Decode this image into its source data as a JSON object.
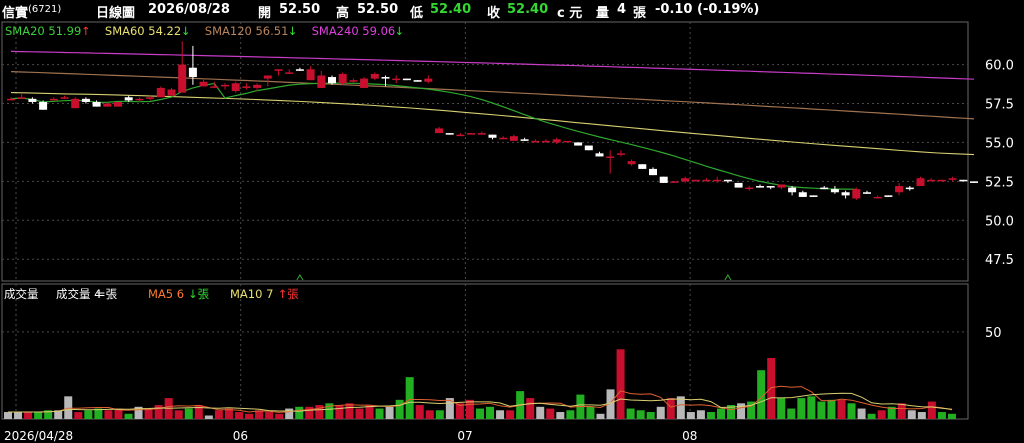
{
  "header": {
    "name": "信實",
    "code": "(6721)",
    "period": "日線圖",
    "date": "2026/08/28",
    "open_label": "開",
    "open": "52.50",
    "high_label": "高",
    "high": "52.50",
    "low_label": "低",
    "low": "52.40",
    "close_label": "收",
    "close": "52.40",
    "unit": "c 元",
    "vol_label": "量",
    "vol": "4",
    "vol_unit": "張",
    "change": "-0.10 (-0.19%)"
  },
  "sma_legend": [
    {
      "label": "SMA20",
      "value": "51.99",
      "arrow": "↑",
      "color": "#3ccf3c",
      "arrow_color": "#ff3333"
    },
    {
      "label": "SMA60",
      "value": "54.22",
      "arrow": "↓",
      "color": "#e8e070",
      "arrow_color": "#33dd33"
    },
    {
      "label": "SMA120",
      "value": "56.51",
      "arrow": "↓",
      "color": "#b8845c",
      "arrow_color": "#33dd33"
    },
    {
      "label": "SMA240",
      "value": "59.06",
      "arrow": "↓",
      "color": "#e040e0",
      "arrow_color": "#33dd33"
    }
  ],
  "vol_legend": [
    {
      "label": "成交量",
      "color": "#ffffff"
    },
    {
      "label": "成交量 4",
      "suffix": "=張",
      "color": "#ffffff",
      "suffix_color": "#ffffff"
    },
    {
      "label": "MA5 6",
      "suffix": "↓張",
      "color": "#ff7a30",
      "suffix_color": "#33dd33"
    },
    {
      "label": "MA10 7",
      "suffix": "↑張",
      "color": "#e8e070",
      "suffix_color": "#ff3333"
    }
  ],
  "colors": {
    "up": "#c8102e",
    "down": "#ffffff",
    "vol_up": "#c8102e",
    "vol_down": "#22b022",
    "vol_flat": "#b8b8b8",
    "grid": "#4a4a4a"
  },
  "chart_data": {
    "type": "candlestick",
    "price_ticks": [
      "60.0",
      "57.5",
      "55.0",
      "52.5",
      "50.0",
      "47.5"
    ],
    "price_tick_values": [
      60,
      57.5,
      55,
      52.5,
      50,
      47.5
    ],
    "ylim": [
      46.1,
      62.8
    ],
    "volume_ticks": [
      "50"
    ],
    "volume_tick_values": [
      50
    ],
    "volume_ylim": [
      0,
      70
    ],
    "x_labels": [
      "2026/04/28",
      "06",
      "07",
      "08"
    ],
    "x_label_index": [
      0,
      21,
      42,
      63
    ],
    "ohlc": [
      [
        57.8,
        57.9,
        57.7,
        57.8
      ],
      [
        57.8,
        58.1,
        57.8,
        57.9
      ],
      [
        57.8,
        57.9,
        57.5,
        57.6
      ],
      [
        57.6,
        57.7,
        57.1,
        57.1
      ],
      [
        57.8,
        57.9,
        57.8,
        57.8
      ],
      [
        57.9,
        58.0,
        57.8,
        57.9
      ],
      [
        57.2,
        57.9,
        57.2,
        57.8
      ],
      [
        57.8,
        57.9,
        57.5,
        57.6
      ],
      [
        57.6,
        57.7,
        57.3,
        57.3
      ],
      [
        57.3,
        57.6,
        57.3,
        57.5
      ],
      [
        57.3,
        57.6,
        57.3,
        57.6
      ],
      [
        57.9,
        58.0,
        57.6,
        57.7
      ],
      [
        57.8,
        57.9,
        57.6,
        57.8
      ],
      [
        57.8,
        58.0,
        57.7,
        57.9
      ],
      [
        57.9,
        58.6,
        57.9,
        58.5
      ],
      [
        58.0,
        58.5,
        58.0,
        58.4
      ],
      [
        58.2,
        61.5,
        58.2,
        60.0
      ],
      [
        59.8,
        61.2,
        58.7,
        59.2
      ],
      [
        58.6,
        59.1,
        58.6,
        58.9
      ],
      [
        58.6,
        58.9,
        58.5,
        58.6
      ],
      [
        58.6,
        58.8,
        58.4,
        58.7
      ],
      [
        58.3,
        58.9,
        58.2,
        58.8
      ],
      [
        58.5,
        58.8,
        58.4,
        58.6
      ],
      [
        58.5,
        58.8,
        58.3,
        58.7
      ],
      [
        59.1,
        59.3,
        58.6,
        59.3
      ],
      [
        59.6,
        59.7,
        59.3,
        59.7
      ],
      [
        59.5,
        59.7,
        59.4,
        59.5
      ],
      [
        59.7,
        59.8,
        59.6,
        59.6
      ],
      [
        59.0,
        59.9,
        59.0,
        59.7
      ],
      [
        58.5,
        59.6,
        58.5,
        59.3
      ],
      [
        59.2,
        59.3,
        58.7,
        58.8
      ],
      [
        58.8,
        59.5,
        58.7,
        59.4
      ],
      [
        58.9,
        59.1,
        58.8,
        59.0
      ],
      [
        58.5,
        59.2,
        58.5,
        59.1
      ],
      [
        59.1,
        59.5,
        59.0,
        59.4
      ],
      [
        59.2,
        59.3,
        58.6,
        59.1
      ],
      [
        59.1,
        59.3,
        58.8,
        59.1
      ],
      [
        59.1,
        59.1,
        59.0,
        59.0
      ],
      [
        59.0,
        59.0,
        58.9,
        58.9
      ],
      [
        58.9,
        59.3,
        58.8,
        59.1
      ],
      [
        55.6,
        56.0,
        55.6,
        55.9
      ],
      [
        55.6,
        55.6,
        55.5,
        55.5
      ],
      [
        55.5,
        55.6,
        55.5,
        55.5
      ],
      [
        55.5,
        55.6,
        55.5,
        55.6
      ],
      [
        55.5,
        55.7,
        55.5,
        55.6
      ],
      [
        55.5,
        55.5,
        55.2,
        55.3
      ],
      [
        55.3,
        55.4,
        55.2,
        55.3
      ],
      [
        55.1,
        55.5,
        55.1,
        55.4
      ],
      [
        55.2,
        55.3,
        55.1,
        55.1
      ],
      [
        55.0,
        55.2,
        55.0,
        55.1
      ],
      [
        55.1,
        55.2,
        55.0,
        55.1
      ],
      [
        55.0,
        55.3,
        54.9,
        55.2
      ],
      [
        55.1,
        55.1,
        55.1,
        55.1
      ],
      [
        55.0,
        55.0,
        54.8,
        54.8
      ],
      [
        54.8,
        54.8,
        54.5,
        54.5
      ],
      [
        54.3,
        54.4,
        54.1,
        54.1
      ],
      [
        54.1,
        54.5,
        53.0,
        54.1
      ],
      [
        54.3,
        54.5,
        54.1,
        54.3
      ],
      [
        53.6,
        53.9,
        53.5,
        53.8
      ],
      [
        53.6,
        53.6,
        53.3,
        53.3
      ],
      [
        53.3,
        53.4,
        52.9,
        52.9
      ],
      [
        52.8,
        52.8,
        52.4,
        52.4
      ],
      [
        52.5,
        52.5,
        52.4,
        52.5
      ],
      [
        52.5,
        52.8,
        52.4,
        52.7
      ],
      [
        52.6,
        52.6,
        52.5,
        52.6
      ],
      [
        52.6,
        52.7,
        52.5,
        52.6
      ],
      [
        52.6,
        52.8,
        52.4,
        52.6
      ],
      [
        52.6,
        52.6,
        52.4,
        52.5
      ],
      [
        52.4,
        52.4,
        52.1,
        52.1
      ],
      [
        52.1,
        52.2,
        51.9,
        52.1
      ],
      [
        52.2,
        52.3,
        52.1,
        52.1
      ],
      [
        52.2,
        52.2,
        52.0,
        52.1
      ],
      [
        52.1,
        52.3,
        52.0,
        52.3
      ],
      [
        52.1,
        52.2,
        51.6,
        51.8
      ],
      [
        51.8,
        51.9,
        51.5,
        51.5
      ],
      [
        51.6,
        51.6,
        51.5,
        51.5
      ],
      [
        52.1,
        52.2,
        52.0,
        52.0
      ],
      [
        52.0,
        52.2,
        51.7,
        51.8
      ],
      [
        51.8,
        51.9,
        51.4,
        51.6
      ],
      [
        51.4,
        52.1,
        51.3,
        52.0
      ],
      [
        51.8,
        51.9,
        51.7,
        51.7
      ],
      [
        51.5,
        51.6,
        51.4,
        51.5
      ],
      [
        51.6,
        51.6,
        51.5,
        51.5
      ],
      [
        51.8,
        52.4,
        51.6,
        52.2
      ],
      [
        52.1,
        52.2,
        51.9,
        52.0
      ],
      [
        52.2,
        52.8,
        52.2,
        52.7
      ],
      [
        52.6,
        52.7,
        52.6,
        52.6
      ],
      [
        52.6,
        52.6,
        52.5,
        52.6
      ],
      [
        52.6,
        52.8,
        52.5,
        52.7
      ],
      [
        52.6,
        52.6,
        52.5,
        52.5
      ],
      [
        52.5,
        52.5,
        52.4,
        52.4
      ]
    ],
    "sma20": [
      57.85,
      58.01,
      58.15,
      58.33,
      58.44,
      58.56,
      58.68,
      58.74,
      58.78,
      58.8,
      58.81,
      58.81,
      58.8,
      58.78,
      58.75,
      58.71,
      58.65,
      58.58,
      58.5,
      58.42,
      58.33,
      58.22,
      58.09,
      57.94,
      57.75,
      57.53,
      57.29,
      57.04,
      56.78,
      56.53,
      56.3,
      56.1,
      55.9,
      55.71,
      55.53,
      55.35,
      55.18,
      55.02,
      54.86,
      54.69,
      54.51,
      54.32,
      54.12,
      53.91,
      53.69,
      53.47,
      53.26,
      53.06,
      52.86,
      52.67,
      52.5,
      52.36,
      52.25,
      52.16,
      52.1,
      52.06,
      52.03,
      52.01,
      52.0,
      51.99
    ],
    "sma20_start": 20,
    "sma60": [
      58.2,
      58.18,
      58.15,
      58.12,
      58.1,
      58.07,
      58.04,
      58.01,
      57.97,
      57.94,
      57.9,
      57.86,
      57.82,
      57.78,
      57.73,
      57.68,
      57.63,
      57.57,
      57.51,
      57.44,
      57.37,
      57.29,
      57.21,
      57.12,
      57.03,
      56.93,
      56.83,
      56.73,
      56.62,
      56.51,
      56.4,
      56.29,
      56.18,
      56.07,
      55.96,
      55.85,
      55.74,
      55.63,
      55.53,
      55.43,
      55.33,
      55.23,
      55.13,
      55.03,
      54.93,
      54.84,
      54.75,
      54.66,
      54.57,
      54.48,
      54.4,
      54.32,
      54.27,
      54.22
    ],
    "sma60_start": 0,
    "sma120_values": [
      59.55,
      56.51
    ],
    "sma240_values": [
      60.85,
      59.06
    ],
    "volume": [
      4,
      4,
      4,
      4,
      5,
      5,
      13,
      4,
      5,
      6,
      5,
      6,
      3,
      7,
      6,
      8,
      12,
      5,
      6,
      8,
      2,
      5,
      6,
      4,
      3,
      5,
      4,
      3,
      6,
      7,
      7,
      8,
      9,
      8,
      9,
      6,
      8,
      6,
      7,
      11,
      24,
      8,
      5,
      5,
      12,
      9,
      11,
      6,
      7,
      5,
      5,
      16,
      12,
      7,
      6,
      4,
      5,
      14,
      7,
      3,
      17,
      40,
      6,
      5,
      4,
      7,
      12,
      13,
      4,
      5,
      4,
      6,
      8,
      9,
      10,
      28,
      35,
      12,
      6,
      12,
      13,
      10,
      11,
      11,
      9,
      6,
      3,
      5,
      7,
      9,
      5,
      4,
      10,
      4,
      3
    ]
  }
}
